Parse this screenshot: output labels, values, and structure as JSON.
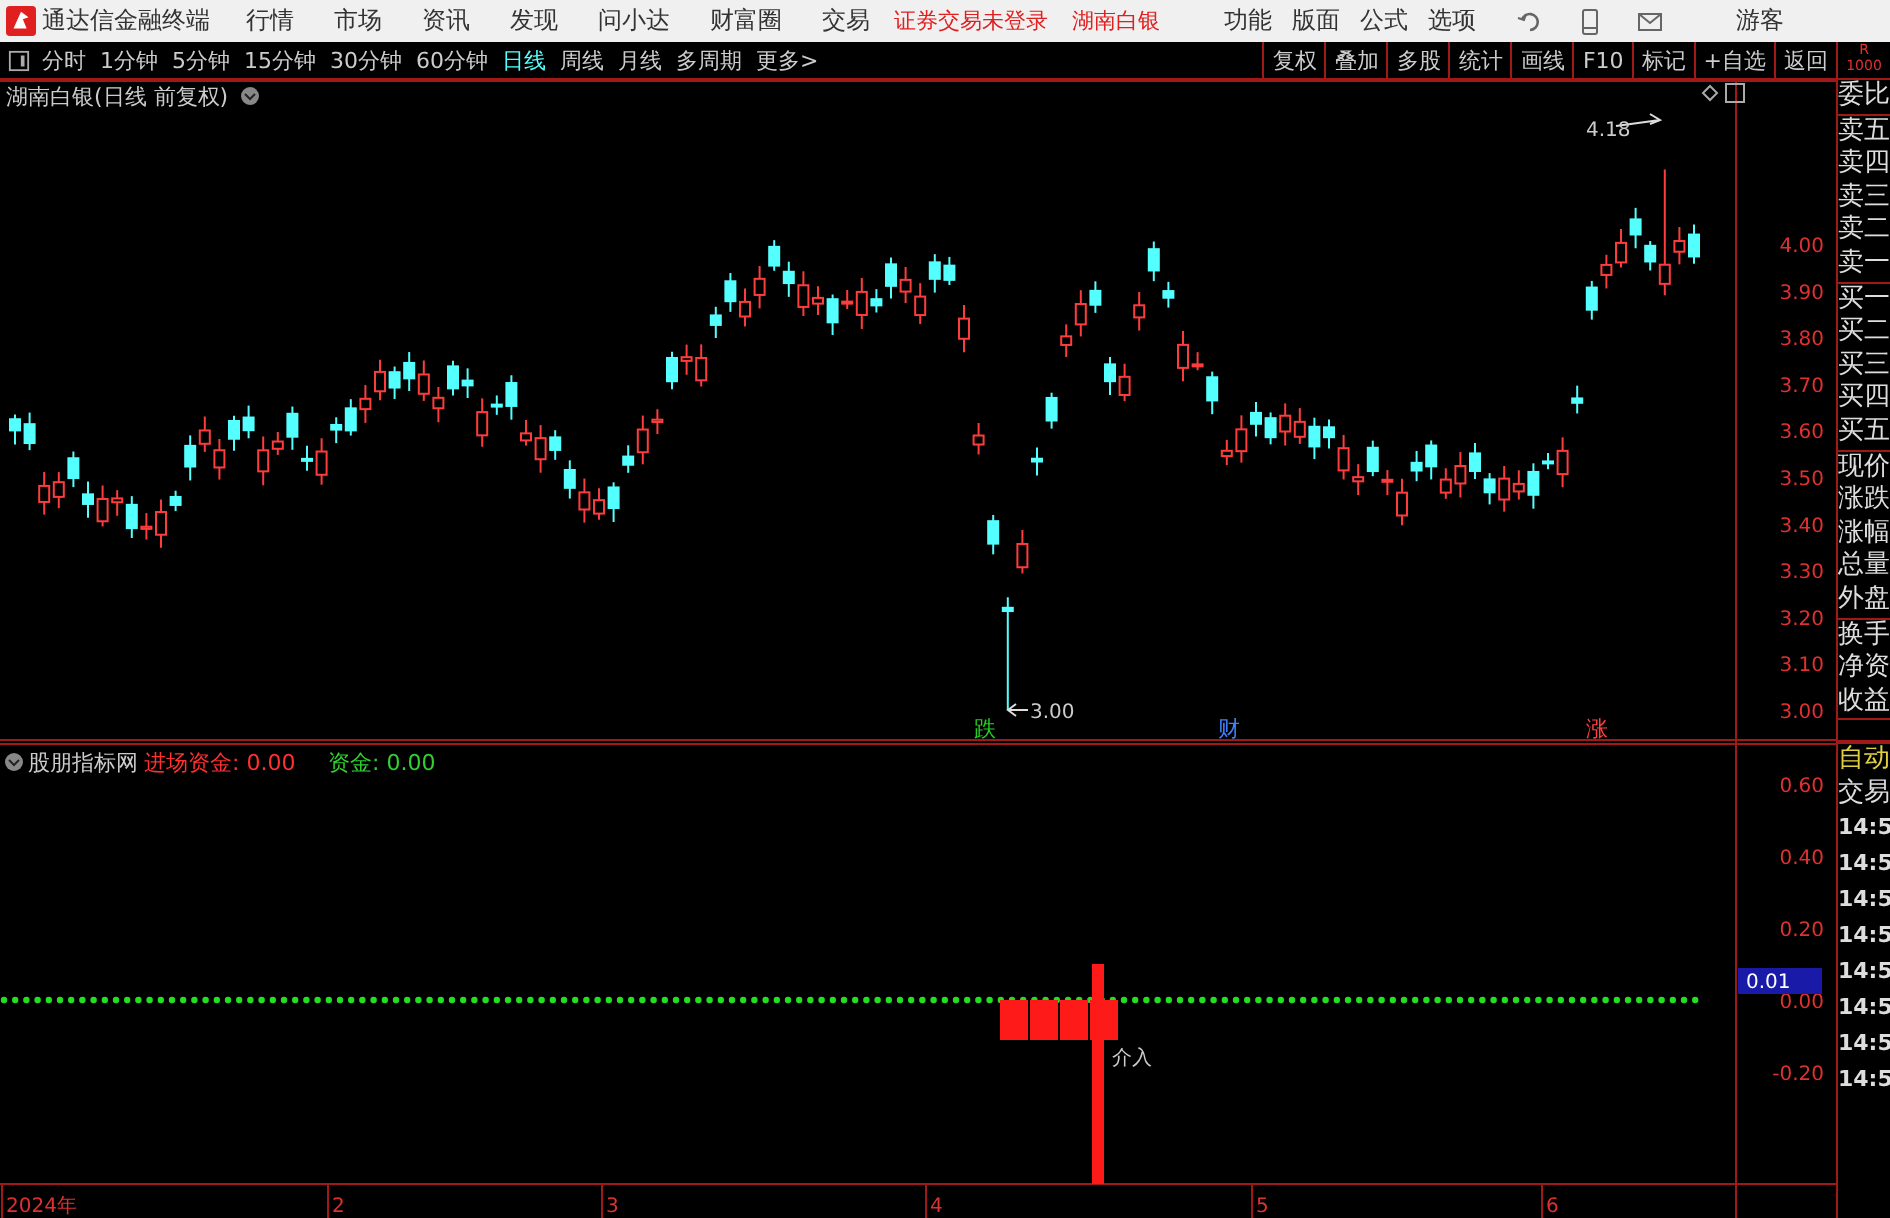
{
  "app_bar": {
    "title": "通达信金融终端",
    "menu": [
      "行情",
      "市场",
      "资讯",
      "发现",
      "问小达",
      "财富圈",
      "交易"
    ],
    "status": [
      "证券交易未登录",
      "湖南白银"
    ],
    "tools": [
      "功能",
      "版面",
      "公式",
      "选项"
    ],
    "user": "游客"
  },
  "period_bar": {
    "periods": [
      {
        "label": "分时",
        "selected": false
      },
      {
        "label": "1分钟",
        "selected": false
      },
      {
        "label": "5分钟",
        "selected": false
      },
      {
        "label": "15分钟",
        "selected": false
      },
      {
        "label": "30分钟",
        "selected": false
      },
      {
        "label": "60分钟",
        "selected": false
      },
      {
        "label": "日线",
        "selected": true
      },
      {
        "label": "周线",
        "selected": false
      },
      {
        "label": "月线",
        "selected": false
      },
      {
        "label": "多周期",
        "selected": false
      },
      {
        "label": "更多>",
        "selected": false
      }
    ],
    "actions": [
      "复权",
      "叠加",
      "多股",
      "统计",
      "画线",
      "F10",
      "标记",
      "+自选",
      "返回"
    ]
  },
  "price_chart": {
    "title": "湖南白银(日线 前复权)",
    "y_axis": [
      "4.00",
      "3.90",
      "3.80",
      "3.70",
      "3.60",
      "3.50",
      "3.40",
      "3.30",
      "3.20",
      "3.10",
      "3.00"
    ],
    "high_label": "4.18",
    "low_label": "3.00",
    "markers": [
      {
        "label": "跌",
        "color": "#20d020"
      },
      {
        "label": "财",
        "color": "#4080ff"
      },
      {
        "label": "涨",
        "color": "#ff4040"
      }
    ]
  },
  "indicator": {
    "name": "股朋指标网",
    "readings": [
      {
        "label": "进场资金: 0.00",
        "color": "#ff3030"
      },
      {
        "label": "资金: 0.00",
        "color": "#30d030"
      }
    ],
    "y_axis": [
      "0.60",
      "0.40",
      "0.20",
      "0.00",
      "-0.20"
    ],
    "cursor_value": "0.01",
    "signal_label": "介入"
  },
  "x_axis": [
    "2024年",
    "2",
    "3",
    "4",
    "5",
    "6"
  ],
  "side_panel": {
    "header": [
      "R",
      "1000"
    ],
    "quote_groups": [
      [
        "委比"
      ],
      [
        "卖五",
        "卖四",
        "卖三",
        "卖二",
        "卖一"
      ],
      [
        "买一",
        "买二",
        "买三",
        "买四",
        "买五"
      ],
      [
        "现价",
        "涨跌",
        "涨幅",
        "总量",
        "外盘"
      ],
      [
        "换手",
        "净资",
        "收益"
      ]
    ],
    "trade_labels": [
      {
        "label": "自动",
        "kind": "mode"
      },
      {
        "label": "交易",
        "kind": "plain"
      }
    ],
    "times": [
      "14:5",
      "14:5",
      "14:5",
      "14:5",
      "14:5",
      "14:5",
      "14:5",
      "14:5"
    ]
  }
}
